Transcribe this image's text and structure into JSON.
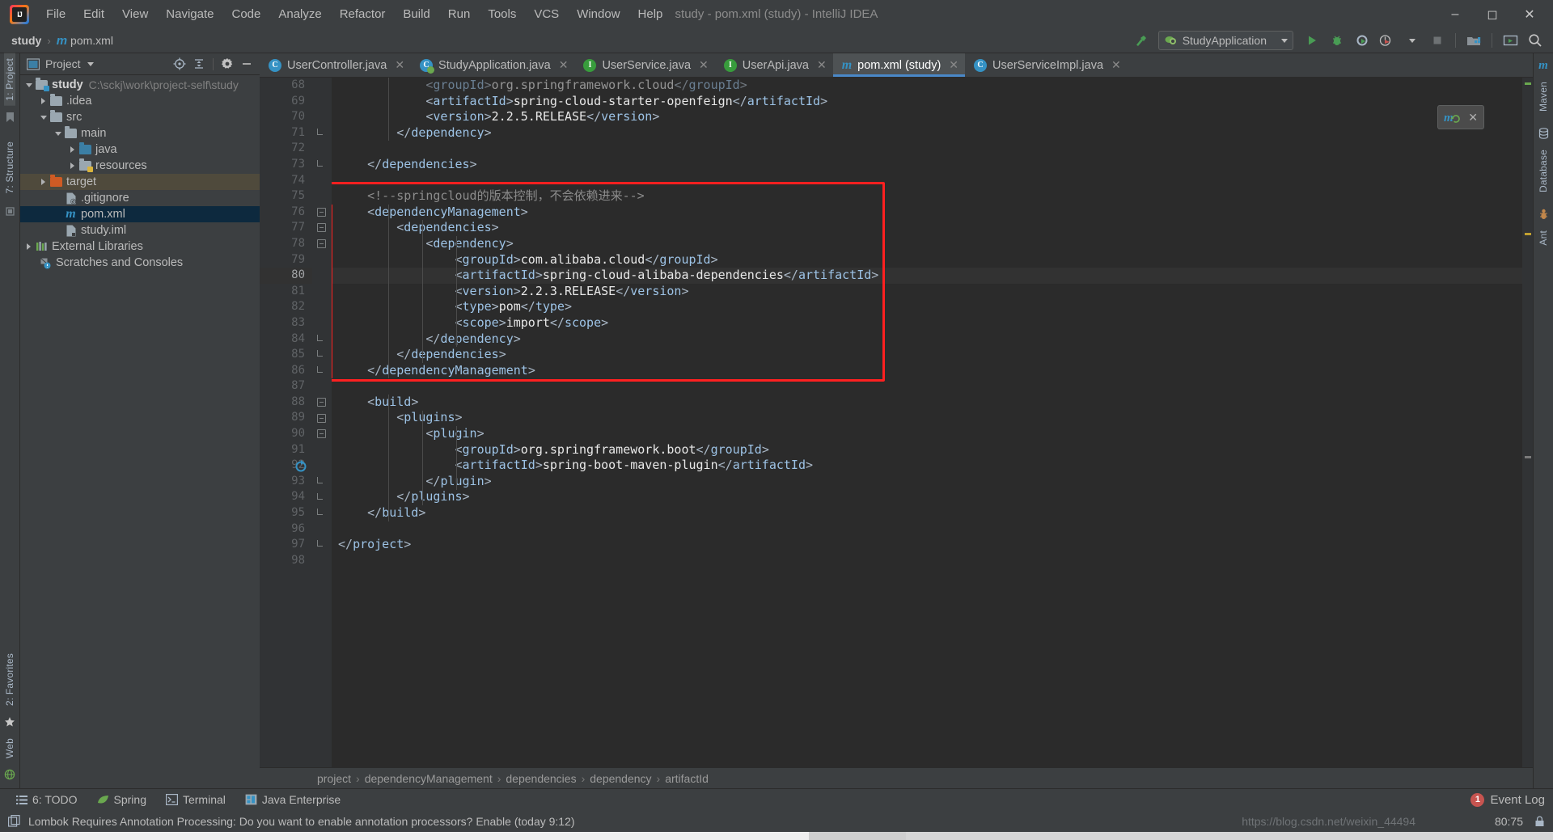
{
  "window": {
    "title": "study - pom.xml (study) - IntelliJ IDEA",
    "minimize": "—",
    "maximize": "❐",
    "close": "✕"
  },
  "menu": {
    "items": [
      "File",
      "Edit",
      "View",
      "Navigate",
      "Code",
      "Analyze",
      "Refactor",
      "Build",
      "Run",
      "Tools",
      "VCS",
      "Window",
      "Help"
    ]
  },
  "navbar": {
    "crumbs": [
      "study",
      "pom.xml"
    ],
    "separator": "›",
    "run_config": "StudyApplication",
    "icons": {
      "hammer": "build-hammer-icon",
      "run": "run-icon",
      "debug": "debug-icon",
      "coverage": "run-with-coverage-icon",
      "profile": "profiler-icon",
      "stop": "stop-icon",
      "project_structure": "project-structure-icon",
      "updates": "updates-icon",
      "search": "search-everywhere-icon"
    }
  },
  "left_strip": {
    "top": [
      "1: Project"
    ],
    "bottom": [
      "2: Favorites",
      "Web"
    ],
    "structure": "7: Structure"
  },
  "right_strip": {
    "items": [
      "m",
      "Maven",
      "Database",
      "Ant"
    ]
  },
  "project": {
    "header_title": "Project",
    "tree": [
      {
        "indent": 0,
        "arrow": "open",
        "icon": "module-folder",
        "label": "study",
        "bold": true,
        "path": "C:\\sckj\\work\\project-self\\study",
        "state": "normal"
      },
      {
        "indent": 1,
        "arrow": "closed",
        "icon": "folder",
        "label": ".idea",
        "bold": false,
        "path": "",
        "state": "normal"
      },
      {
        "indent": 1,
        "arrow": "open",
        "icon": "folder",
        "label": "src",
        "bold": false,
        "path": "",
        "state": "normal"
      },
      {
        "indent": 2,
        "arrow": "open",
        "icon": "folder",
        "label": "main",
        "bold": false,
        "path": "",
        "state": "normal"
      },
      {
        "indent": 3,
        "arrow": "closed",
        "icon": "folder-blue",
        "label": "java",
        "bold": false,
        "path": "",
        "state": "normal"
      },
      {
        "indent": 3,
        "arrow": "closed",
        "icon": "folder-resources",
        "label": "resources",
        "bold": false,
        "path": "",
        "state": "normal"
      },
      {
        "indent": 1,
        "arrow": "closed",
        "icon": "folder-orange",
        "label": "target",
        "bold": false,
        "path": "",
        "state": "highlight"
      },
      {
        "indent": 2,
        "arrow": "none",
        "icon": "gitignore-file",
        "label": ".gitignore",
        "bold": false,
        "path": "",
        "state": "normal"
      },
      {
        "indent": 2,
        "arrow": "none",
        "icon": "maven-file",
        "label": "pom.xml",
        "bold": false,
        "path": "",
        "state": "selected"
      },
      {
        "indent": 2,
        "arrow": "none",
        "icon": "iml-file",
        "label": "study.iml",
        "bold": false,
        "path": "",
        "state": "normal"
      },
      {
        "indent": 0,
        "arrow": "closed",
        "icon": "libraries",
        "label": "External Libraries",
        "bold": false,
        "path": "",
        "state": "normal"
      },
      {
        "indent": 0,
        "arrow": "none",
        "icon": "scratches",
        "label": "Scratches and Consoles",
        "bold": false,
        "path": "",
        "state": "normal"
      }
    ]
  },
  "tabs": [
    {
      "label": "UserController.java",
      "icon": "class-icon",
      "active": false
    },
    {
      "label": "StudyApplication.java",
      "icon": "spring-class-icon",
      "active": false
    },
    {
      "label": "UserService.java",
      "icon": "interface-icon",
      "active": false
    },
    {
      "label": "UserApi.java",
      "icon": "interface-icon",
      "active": false
    },
    {
      "label": "pom.xml (study)",
      "icon": "maven-icon",
      "active": true
    },
    {
      "label": "UserServiceImpl.java",
      "icon": "class-icon",
      "active": false
    }
  ],
  "editor": {
    "first_line": 68,
    "highlighted_line": 80,
    "lines": [
      {
        "n": 68,
        "text": "            <groupId>org.springframework.cloud</groupId>",
        "clipped": true
      },
      {
        "n": 69,
        "text": "            <artifactId>spring-cloud-starter-openfeign</artifactId>"
      },
      {
        "n": 70,
        "text": "            <version>2.2.5.RELEASE</version>"
      },
      {
        "n": 71,
        "text": "        </dependency>"
      },
      {
        "n": 72,
        "text": ""
      },
      {
        "n": 73,
        "text": "    </dependencies>"
      },
      {
        "n": 74,
        "text": ""
      },
      {
        "n": 75,
        "text": "    <!--springcloud的版本控制，不会依赖进来-->"
      },
      {
        "n": 76,
        "text": "    <dependencyManagement>"
      },
      {
        "n": 77,
        "text": "        <dependencies>"
      },
      {
        "n": 78,
        "text": "            <dependency>"
      },
      {
        "n": 79,
        "text": "                <groupId>com.alibaba.cloud</groupId>"
      },
      {
        "n": 80,
        "text": "                <artifactId>spring-cloud-alibaba-dependencies</artifactId>"
      },
      {
        "n": 81,
        "text": "                <version>2.2.3.RELEASE</version>"
      },
      {
        "n": 82,
        "text": "                <type>pom</type>"
      },
      {
        "n": 83,
        "text": "                <scope>import</scope>"
      },
      {
        "n": 84,
        "text": "            </dependency>"
      },
      {
        "n": 85,
        "text": "        </dependencies>"
      },
      {
        "n": 86,
        "text": "    </dependencyManagement>"
      },
      {
        "n": 87,
        "text": ""
      },
      {
        "n": 88,
        "text": "    <build>"
      },
      {
        "n": 89,
        "text": "        <plugins>"
      },
      {
        "n": 90,
        "text": "            <plugin>"
      },
      {
        "n": 91,
        "text": "                <groupId>org.springframework.boot</groupId>"
      },
      {
        "n": 92,
        "text": "                <artifactId>spring-boot-maven-plugin</artifactId>"
      },
      {
        "n": 93,
        "text": "            </plugin>"
      },
      {
        "n": 94,
        "text": "        </plugins>"
      },
      {
        "n": 95,
        "text": "    </build>"
      },
      {
        "n": 96,
        "text": ""
      },
      {
        "n": 97,
        "text": "</project>"
      },
      {
        "n": 98,
        "text": ""
      }
    ],
    "annotation": {
      "type": "red-rectangle",
      "color": "#ff2020",
      "from_line": 75,
      "to_line": 86
    }
  },
  "breadcrumb": {
    "items": [
      "project",
      "dependencyManagement",
      "dependencies",
      "dependency",
      "artifactId"
    ],
    "separator": "›"
  },
  "tool_window_bar": {
    "items": [
      {
        "label": "6: TODO",
        "icon": "todo-icon",
        "mnemonic": "6"
      },
      {
        "label": "Spring",
        "icon": "spring-leaf-icon",
        "mnemonic": ""
      },
      {
        "label": "Terminal",
        "icon": "terminal-icon",
        "mnemonic": ""
      },
      {
        "label": "Java Enterprise",
        "icon": "java-enterprise-icon",
        "mnemonic": ""
      }
    ],
    "event_log": {
      "label": "Event Log",
      "count": "1"
    }
  },
  "status": {
    "message": "Lombok Requires Annotation Processing: Do you want to enable annotation processors? Enable (today 9:12)",
    "caret_position": "80:75",
    "watermark": "https://blog.csdn.net/weixin_44494"
  },
  "colors": {
    "accent": "#4a88c7",
    "annotation_red": "#ff2020",
    "selection_blue": "#0d293e",
    "target_highlight": "#4f4a3c",
    "editor_bg": "#2b2b2b",
    "panel_bg": "#3c3f41"
  }
}
